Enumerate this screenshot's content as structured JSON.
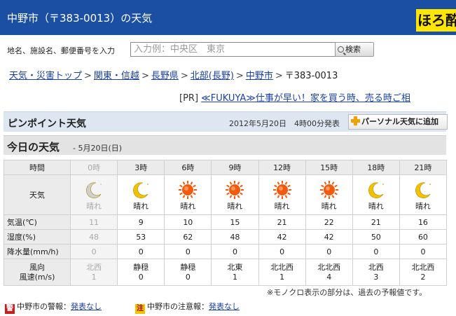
{
  "header": {
    "title": "中野市（〒383-0013）の天気",
    "ad_text": "ほろ酔"
  },
  "search": {
    "label": "地名、施設名、郵便番号を入力",
    "placeholder": "入力例：中央区　東京",
    "button_label": "検索"
  },
  "breadcrumb": {
    "items": [
      "天気・災害トップ",
      "関東・信越",
      "長野県",
      "北部(長野)",
      "中野市"
    ],
    "current": "〒383-0013"
  },
  "pr": {
    "tag": "[PR]",
    "link_text": "≪FUKUYA≫仕事が早い！家を買う時、売る時ご相"
  },
  "pinpoint": {
    "title": "ピンポイント天気",
    "announced": "2012年5月20日　4時00分発表",
    "add_button": "パーソナル天気に追加"
  },
  "today": {
    "title": "今日の天気",
    "date": "- 5月20日(日)"
  },
  "forecast": {
    "labels": {
      "time": "時間",
      "weather": "天気",
      "temp": "気温(℃)",
      "humidity": "湿度(%)",
      "precip": "降水量(mm/h)",
      "wind_dir": "風向",
      "wind_speed": "風速(m/s)"
    },
    "slots": [
      {
        "time": "0時",
        "icon": "moon-icon",
        "weather": "晴れ",
        "temp": "11",
        "humidity": "48",
        "precip": "0",
        "wind_dir": "北西",
        "wind_speed": "1",
        "past": true
      },
      {
        "time": "3時",
        "icon": "moon-icon",
        "weather": "晴れ",
        "temp": "9",
        "humidity": "53",
        "precip": "0",
        "wind_dir": "静穏",
        "wind_speed": "0",
        "past": false
      },
      {
        "time": "6時",
        "icon": "sun-icon",
        "weather": "晴れ",
        "temp": "10",
        "humidity": "62",
        "precip": "0",
        "wind_dir": "静穏",
        "wind_speed": "0",
        "past": false
      },
      {
        "time": "9時",
        "icon": "sun-icon",
        "weather": "晴れ",
        "temp": "15",
        "humidity": "48",
        "precip": "0",
        "wind_dir": "北東",
        "wind_speed": "1",
        "past": false
      },
      {
        "time": "12時",
        "icon": "sun-icon",
        "weather": "晴れ",
        "temp": "21",
        "humidity": "42",
        "precip": "0",
        "wind_dir": "北北西",
        "wind_speed": "1",
        "past": false
      },
      {
        "time": "15時",
        "icon": "sun-icon",
        "weather": "晴れ",
        "temp": "22",
        "humidity": "42",
        "precip": "0",
        "wind_dir": "北北西",
        "wind_speed": "4",
        "past": false
      },
      {
        "time": "18時",
        "icon": "moon-icon",
        "weather": "晴れ",
        "temp": "21",
        "humidity": "50",
        "precip": "0",
        "wind_dir": "北西",
        "wind_speed": "3",
        "past": false
      },
      {
        "time": "21時",
        "icon": "moon-icon",
        "weather": "晴れ",
        "temp": "16",
        "humidity": "60",
        "precip": "0",
        "wind_dir": "北北西",
        "wind_speed": "2",
        "past": false
      }
    ]
  },
  "note": "※モノクロ表示の部分は、過去の予報値です。",
  "warnings": {
    "alert_badge": "警",
    "alert_label": "中野市の警報：",
    "alert_link": "発表なし",
    "caution_badge": "注",
    "caution_label": "中野市の注意報：",
    "caution_link": "発表なし"
  },
  "colors": {
    "header_bg": "#1a4fa3",
    "link": "#1a3fa8",
    "alert_badge": "#c81e1e",
    "caution_badge": "#f2c200",
    "sun": "#f25a10",
    "moon": "#f2c200"
  }
}
